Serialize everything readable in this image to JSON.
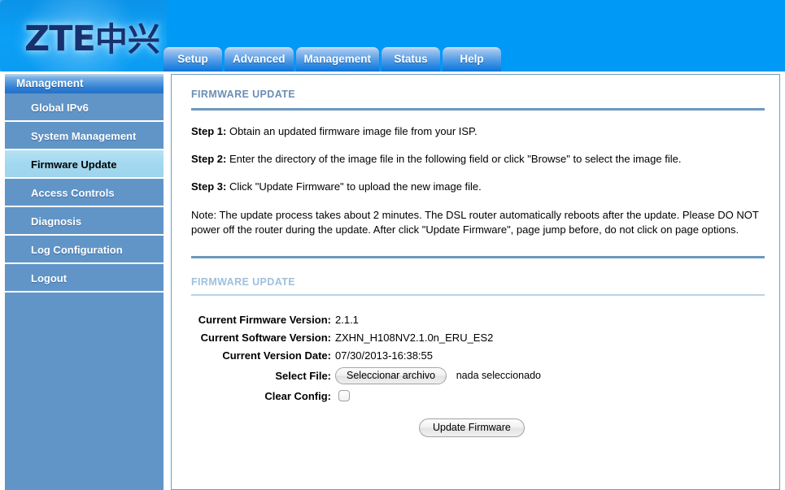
{
  "banner": {
    "logo_text": "ZTE",
    "logo_cn": "中兴"
  },
  "tabs": [
    {
      "label": "Setup"
    },
    {
      "label": "Advanced"
    },
    {
      "label": "Management"
    },
    {
      "label": "Status"
    },
    {
      "label": "Help"
    }
  ],
  "sidebar": {
    "header": "Management",
    "items": [
      {
        "label": "Global IPv6"
      },
      {
        "label": "System Management"
      },
      {
        "label": "Firmware Update"
      },
      {
        "label": "Access Controls"
      },
      {
        "label": "Diagnosis"
      },
      {
        "label": "Log Configuration"
      },
      {
        "label": "Logout"
      }
    ]
  },
  "main": {
    "title": "FIRMWARE UPDATE",
    "steps": [
      {
        "label": "Step 1:",
        "text": " Obtain an updated firmware image file from your ISP."
      },
      {
        "label": "Step 2:",
        "text": " Enter the directory of the image file in the following field or click \"Browse\" to select the image file."
      },
      {
        "label": "Step 3:",
        "text": " Click \"Update Firmware\" to upload the new image file."
      }
    ],
    "note": "Note: The update process takes about 2 minutes. The DSL router automatically reboots after the update. Please DO NOT power off the router during the update. After click \"Update Firmware\", page jump before, do not click on page options.",
    "section_title": "FIRMWARE UPDATE",
    "fields": {
      "firmware_label": "Current Firmware Version:",
      "firmware_value": "2.1.1",
      "software_label": "Current Software Version:",
      "software_value": "ZXHN_H108NV2.1.0n_ERU_ES2",
      "date_label": "Current Version Date:",
      "date_value": "07/30/2013-16:38:55",
      "select_file_label": "Select File:",
      "file_button": "Seleccionar archivo",
      "file_status": "nada seleccionado",
      "clear_config_label": "Clear Config:"
    },
    "submit_label": "Update Firmware"
  },
  "colors": {
    "banner_blue": "#0099f5",
    "sidebar_blue": "#6195c8",
    "active_item": "#a2d8ef",
    "rule_blue": "#6d98c0",
    "title_blue": "#6b8fb5"
  }
}
